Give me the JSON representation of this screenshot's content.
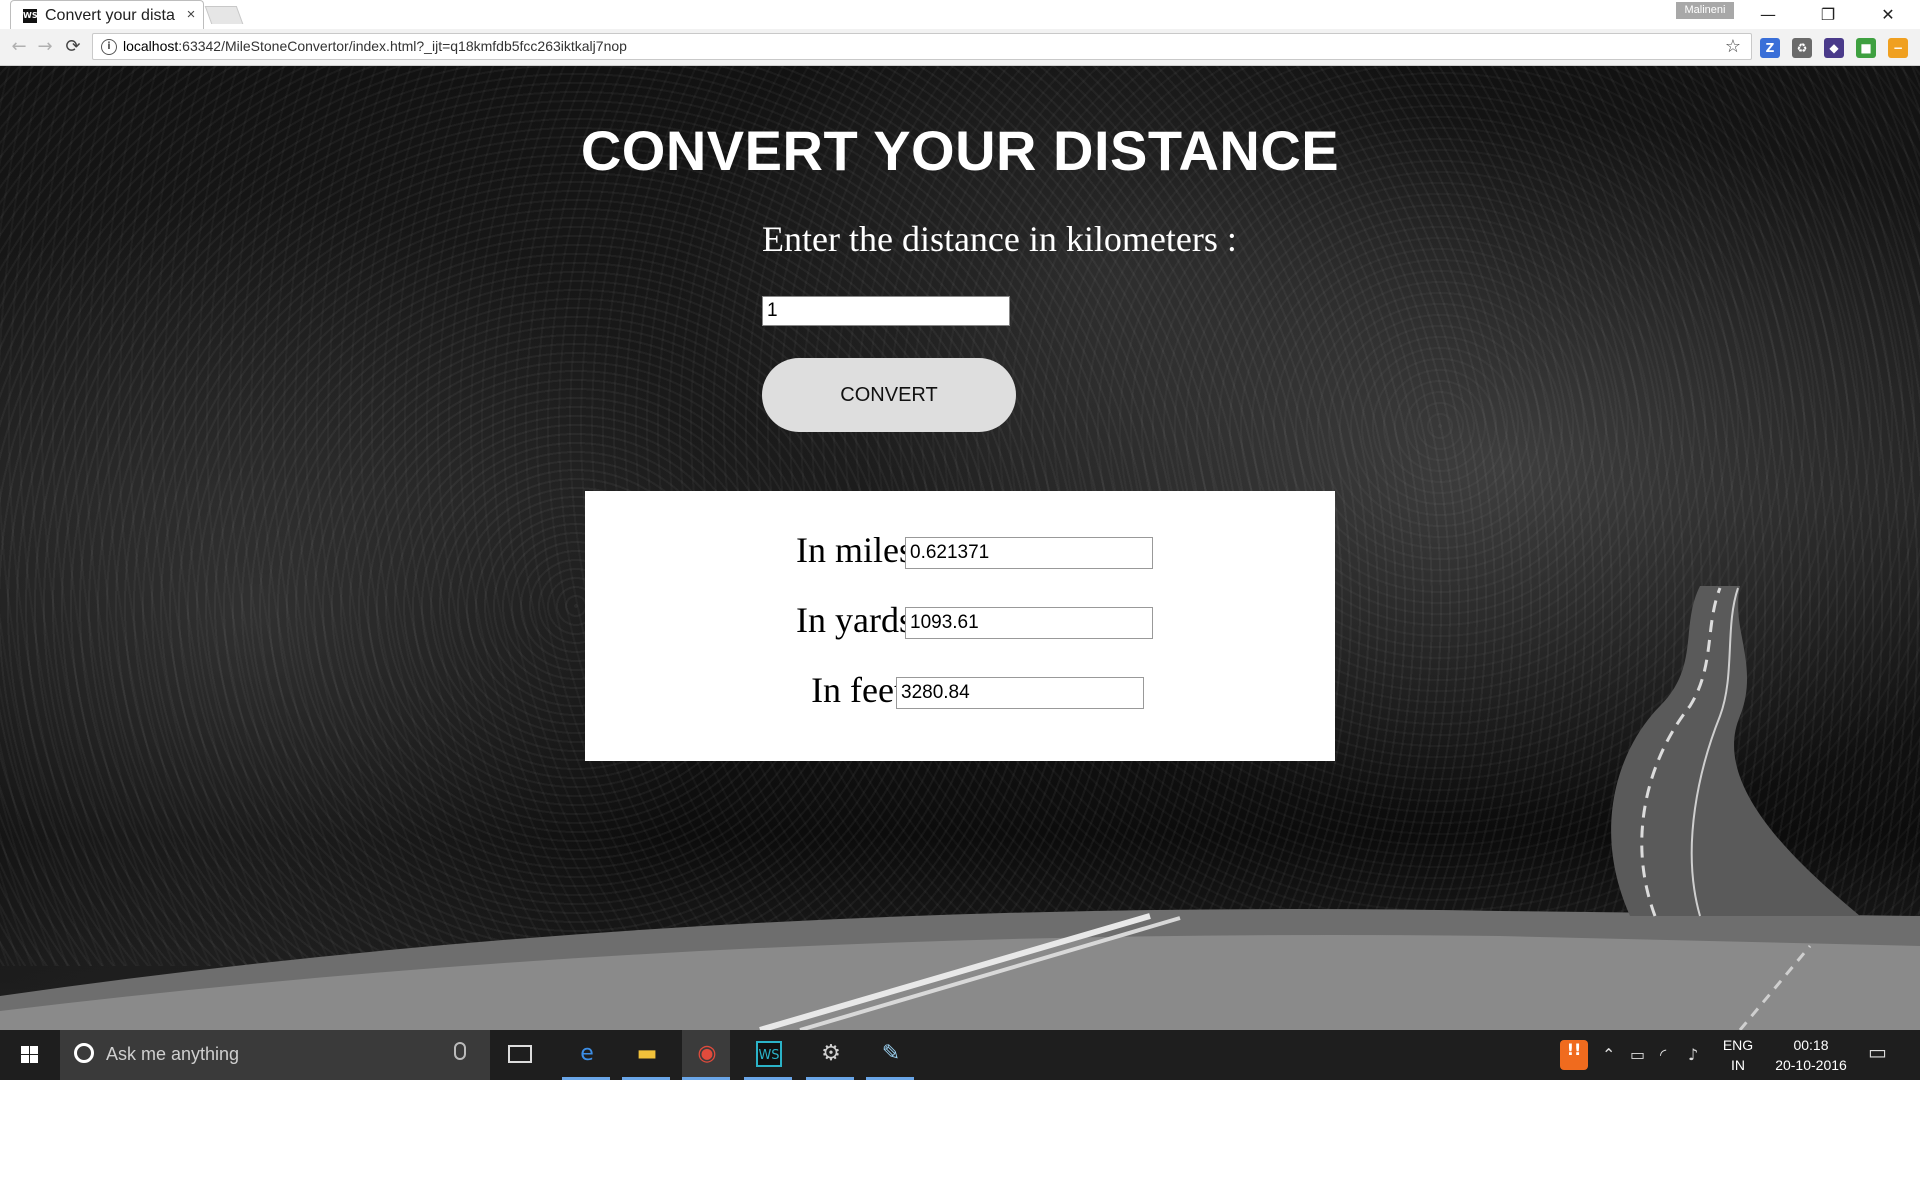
{
  "browser": {
    "tab_title": "Convert your distan",
    "tab_close": "×",
    "favicon_text": "WS",
    "profile_name": "Malineni",
    "url_host": "localhost",
    "url_rest": ":63342/MileStoneConvertor/index.html?_ijt=q18kmfdb5fcc263iktkalj7nop",
    "window_controls": {
      "minimize": "—",
      "restore": "❐",
      "close": "✕"
    },
    "nav": {
      "back": "←",
      "forward": "→",
      "reload": "⟳"
    },
    "info_icon": "i",
    "star_icon": "☆",
    "extensions": [
      {
        "name": "z-extension-icon",
        "glyph": "Z",
        "color": "#3a6fd8"
      },
      {
        "name": "recycle-extension-icon",
        "glyph": "♻",
        "color": "#6a6a6a"
      },
      {
        "name": "purple-extension-icon",
        "glyph": "◆",
        "color": "#4a3a8a"
      },
      {
        "name": "green-extension-icon",
        "glyph": "■",
        "color": "#3ea040"
      },
      {
        "name": "orange-extension-icon",
        "glyph": "−",
        "color": "#f0a020"
      }
    ]
  },
  "page": {
    "title": "CONVERT YOUR DISTANCE",
    "prompt": "Enter the distance in kilometers :",
    "km_value": "1",
    "convert_label": "CONVERT",
    "results": {
      "miles_label": "In miles :",
      "miles_value": "0.621371",
      "yards_label": "In yards :",
      "yards_value": "1093.61",
      "feet_label": "In feet :",
      "feet_value": "3280.84"
    }
  },
  "taskbar": {
    "search_placeholder": "Ask me anything",
    "apps": [
      {
        "name": "edge-app-icon",
        "glyph": "e",
        "color": "#3c8ee6"
      },
      {
        "name": "file-explorer-app-icon",
        "glyph": "▬",
        "color": "#f2c23a"
      },
      {
        "name": "chrome-app-icon",
        "glyph": "◉",
        "color": "#e04b3c"
      },
      {
        "name": "webstorm-app-icon",
        "glyph": "WS",
        "color": "#2bb3c8"
      },
      {
        "name": "settings-app-icon",
        "glyph": "⚙",
        "color": "#d0d0d0"
      },
      {
        "name": "paint-app-icon",
        "glyph": "✎",
        "color": "#9bd0f0"
      }
    ],
    "language_top": "ENG",
    "language_bottom": "IN",
    "time": "00:18",
    "date": "20-10-2016"
  }
}
